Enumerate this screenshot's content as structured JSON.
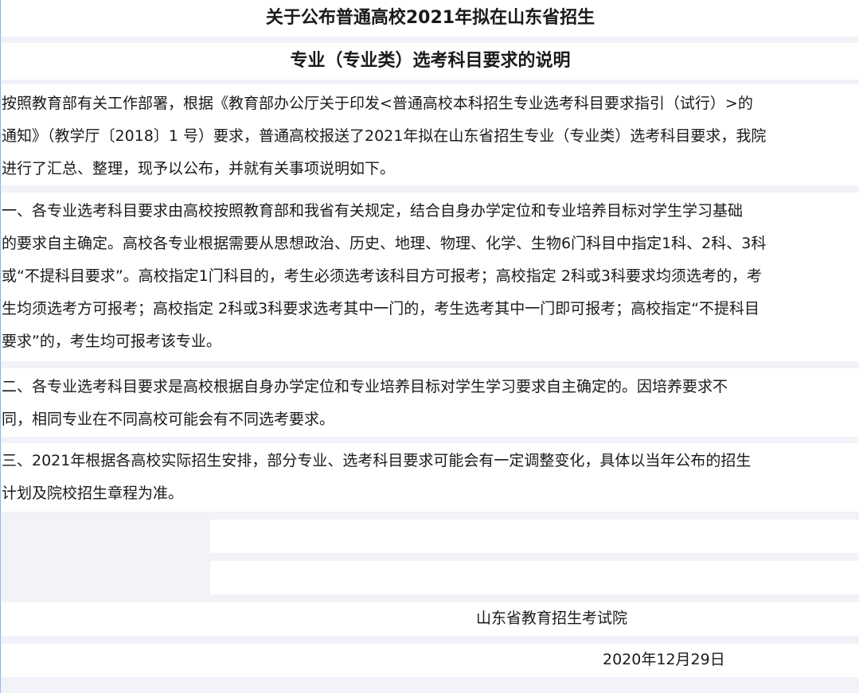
{
  "title": {
    "line1": "关于公布普通高校2021年拟在山东省招生",
    "line2": "专业（专业类）选考科目要求的说明"
  },
  "intro": {
    "lines": [
      "      按照教育部有关工作部署，根据《教育部办公厅关于印发<普通高校本科招生专业选考科目要求指引（试行）>的",
      "通知》（教学厅〔2018〕1 号）要求，普通高校报送了2021年拟在山东省招生专业（专业类）选考科目要求，我院",
      "进行了汇总、整理，现予以公布，并就有关事项说明如下。"
    ]
  },
  "section1": {
    "lines": [
      "       一、各专业选考科目要求由高校按照教育部和我省有关规定，结合自身办学定位和专业培养目标对学生学习基础",
      "的要求自主确定。高校各专业根据需要从思想政治、历史、地理、物理、化学、生物6门科目中指定1科、2科、3科",
      "或“不提科目要求”。高校指定1门科目的，考生必须选考该科目方可报考；高校指定 2科或3科要求均须选考的，考",
      "生均须选考方可报考；高校指定 2科或3科要求选考其中一门的，考生选考其中一门即可报考；高校指定“不提科目",
      "要求”的，考生均可报考该专业。"
    ]
  },
  "section2": {
    "lines": [
      "       二、各专业选考科目要求是高校根据自身办学定位和专业培养目标对学生学习要求自主确定的。因培养要求不",
      "同，相同专业在不同高校可能会有不同选考要求。"
    ]
  },
  "section3": {
    "lines": [
      "      三、2021年根据各高校实际招生安排，部分专业、选考科目要求可能会有一定调整变化，具体以当年公布的招生",
      "计划及院校招生章程为准。"
    ]
  },
  "signature": {
    "org": "山东省教育招生考试院",
    "date": "2020年12月29日"
  }
}
